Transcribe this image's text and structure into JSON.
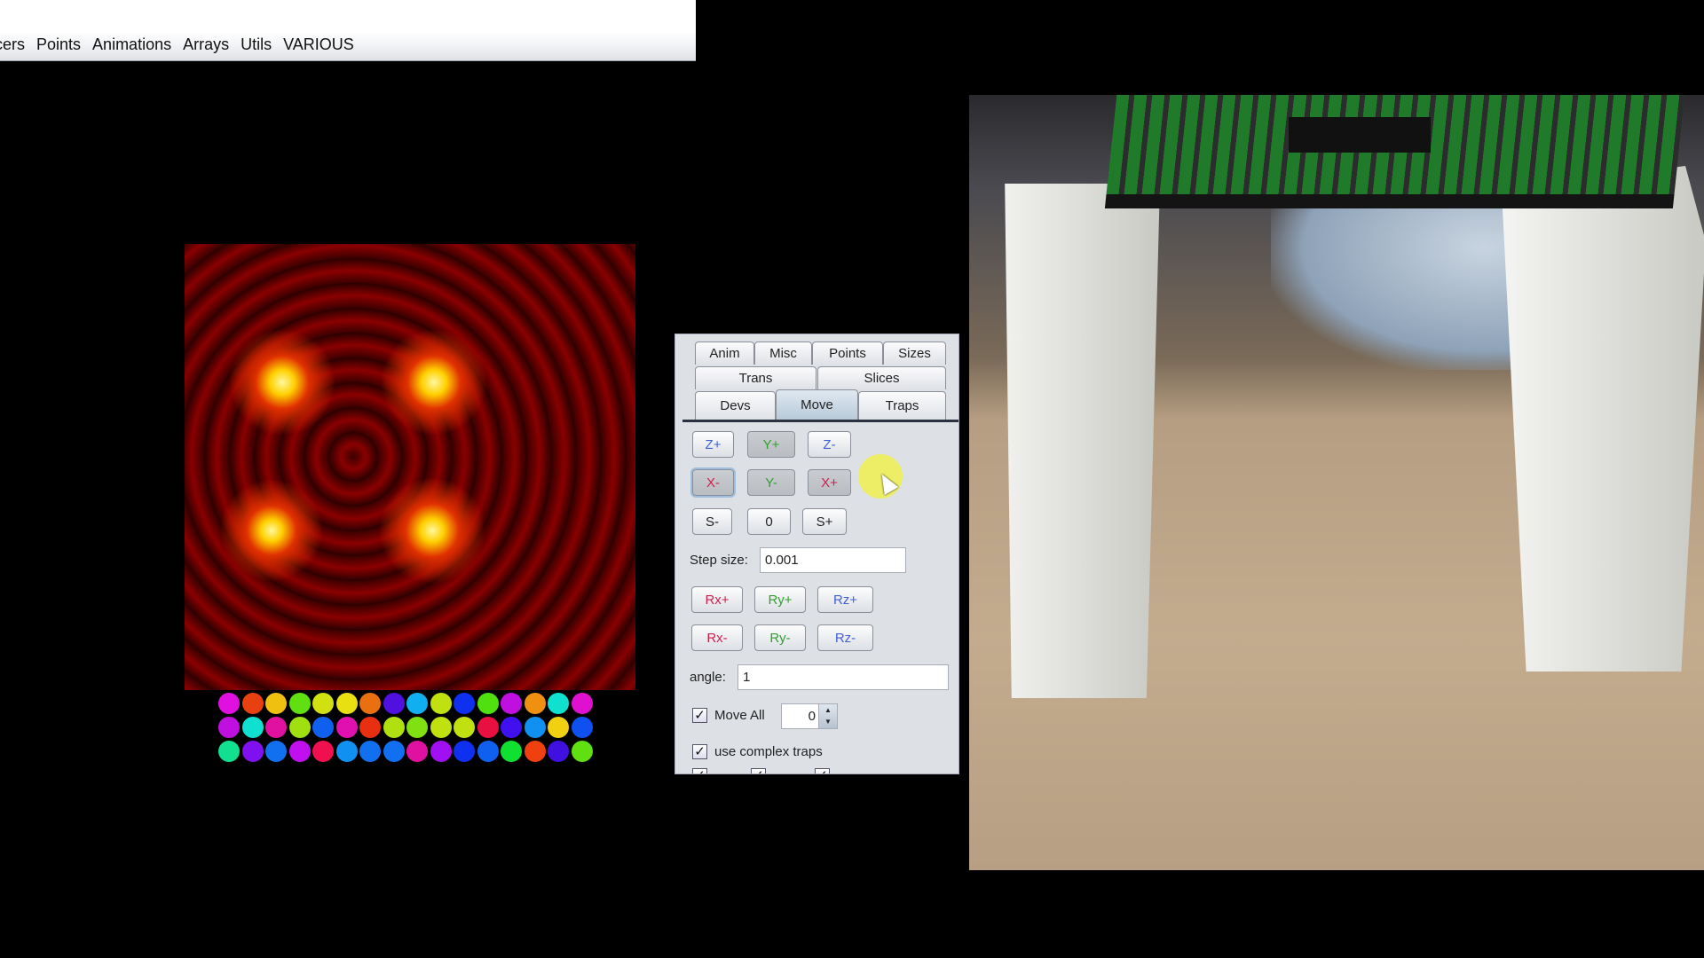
{
  "menubar": {
    "items": [
      "cers",
      "Points",
      "Animations",
      "Arrays",
      "Utils",
      "VARIOUS"
    ]
  },
  "panel": {
    "tabs_row1": [
      "Anim",
      "Misc",
      "Points",
      "Sizes"
    ],
    "tabs_row2": [
      "Trans",
      "Slices"
    ],
    "tabs_row3": [
      "Devs",
      "Move",
      "Traps"
    ],
    "active_tab": "Move",
    "move_buttons": {
      "z_plus": "Z+",
      "y_plus": "Y+",
      "z_minus": "Z-",
      "x_minus": "X-",
      "y_minus": "Y-",
      "x_plus": "X+",
      "s_minus": "S-",
      "s_zero": "0",
      "s_plus": "S+"
    },
    "step_size_label": "Step size:",
    "step_size_value": "0.001",
    "rotate_buttons": {
      "rx_plus": "Rx+",
      "ry_plus": "Ry+",
      "rz_plus": "Rz+",
      "rx_minus": "Rx-",
      "ry_minus": "Ry-",
      "rz_minus": "Rz-"
    },
    "angle_label": "angle:",
    "angle_value": "1",
    "move_all_label": "Move All",
    "move_all_checked": true,
    "move_all_value": "0",
    "complex_traps_label": "use complex traps",
    "complex_traps_checked": true,
    "colors": {
      "x": "#d0204a",
      "y": "#30a030",
      "z": "#4060d8"
    }
  },
  "trap_array": {
    "rows": [
      [
        "#e010e0",
        "#e84010",
        "#f0c010",
        "#60e010",
        "#d0e010",
        "#e8e010",
        "#e87010",
        "#5010e0",
        "#10b0f0",
        "#c0e010",
        "#1030f0",
        "#50e010",
        "#c010e0",
        "#f09010",
        "#10e0d0",
        "#e010d0"
      ],
      [
        "#c010e0",
        "#10e0d0",
        "#e010a0",
        "#a0e010",
        "#1060f0",
        "#e010b0",
        "#e83010",
        "#b0e010",
        "#80e010",
        "#c0e010",
        "#c0e010",
        "#e81040",
        "#4010f0",
        "#1090f0",
        "#f0d010",
        "#1050f0"
      ],
      [
        "#10e090",
        "#8010f0",
        "#1070f0",
        "#c010f0",
        "#f01050",
        "#1090f0",
        "#1070f0",
        "#1070f0",
        "#e010a0",
        "#a010f0",
        "#1030f0",
        "#1060f0",
        "#10e030",
        "#f04010",
        "#4010e0",
        "#60e010"
      ]
    ]
  }
}
